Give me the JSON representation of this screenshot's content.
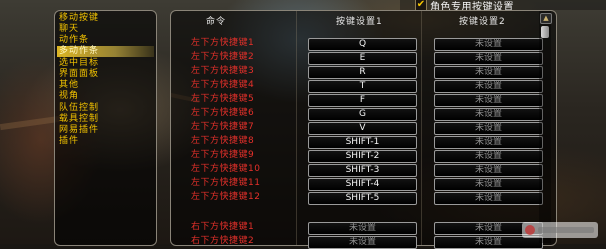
{
  "header": {
    "character_specific_label": "角色专用按键设置",
    "character_specific_checked": true
  },
  "categories": [
    {
      "label": "移动按键",
      "selected": false
    },
    {
      "label": "聊天",
      "selected": false
    },
    {
      "label": "动作条",
      "selected": false
    },
    {
      "label": "多动作条",
      "selected": true
    },
    {
      "label": "选中目标",
      "selected": false
    },
    {
      "label": "界面面板",
      "selected": false
    },
    {
      "label": "其他",
      "selected": false
    },
    {
      "label": "视角",
      "selected": false
    },
    {
      "label": "队伍控制",
      "selected": false
    },
    {
      "label": "载具控制",
      "selected": false
    },
    {
      "label": "网易插件",
      "selected": false
    },
    {
      "label": "插件",
      "selected": false
    }
  ],
  "columns": {
    "command": "命令",
    "binding1": "按键设置1",
    "binding2": "按键设置2"
  },
  "rows": [
    {
      "command": "左下方快捷键1",
      "key1": "Q",
      "key2": "未设置"
    },
    {
      "command": "左下方快捷键2",
      "key1": "E",
      "key2": "未设置"
    },
    {
      "command": "左下方快捷键3",
      "key1": "R",
      "key2": "未设置"
    },
    {
      "command": "左下方快捷键4",
      "key1": "T",
      "key2": "未设置"
    },
    {
      "command": "左下方快捷键5",
      "key1": "F",
      "key2": "未设置"
    },
    {
      "command": "左下方快捷键6",
      "key1": "G",
      "key2": "未设置"
    },
    {
      "command": "左下方快捷键7",
      "key1": "V",
      "key2": "未设置"
    },
    {
      "command": "左下方快捷键8",
      "key1": "SHIFT-1",
      "key2": "未设置"
    },
    {
      "command": "左下方快捷键9",
      "key1": "SHIFT-2",
      "key2": "未设置"
    },
    {
      "command": "左下方快捷键10",
      "key1": "SHIFT-3",
      "key2": "未设置"
    },
    {
      "command": "左下方快捷键11",
      "key1": "SHIFT-4",
      "key2": "未设置"
    },
    {
      "command": "左下方快捷键12",
      "key1": "SHIFT-5",
      "key2": "未设置"
    },
    {
      "command": "右下方快捷键1",
      "key1": "未设置",
      "key2": "未设置"
    },
    {
      "command": "右下方快捷键2",
      "key1": "未设置",
      "key2": "未设置"
    }
  ],
  "icons": {
    "scroll_up": "scroll-up-arrow-icon",
    "scroll_down": "scroll-down-arrow-icon",
    "checkmark": "checkmark-icon"
  },
  "colors": {
    "category_text": "#f2c200",
    "command_text": "#e5302a",
    "unset_text": "#8e8e8e",
    "key_text": "#f5f5f5",
    "selected_highlight": "#ffd228"
  }
}
